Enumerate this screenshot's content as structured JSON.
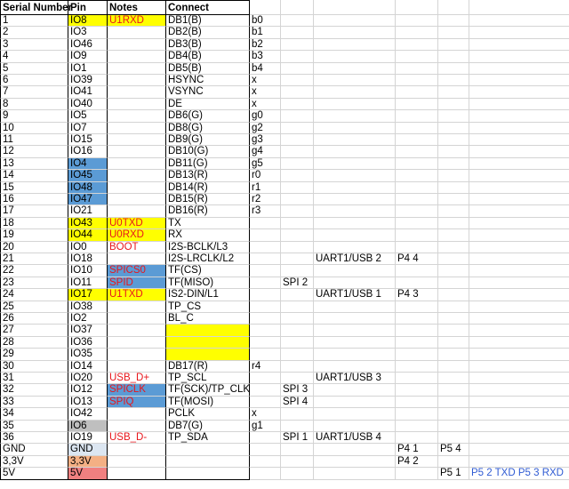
{
  "header": {
    "serial": "Serial Number",
    "pin": "Pin",
    "notes": "Notes",
    "connect": "Connect"
  },
  "colors": {
    "yellow": "#ffff00",
    "blue": "#5b9bd5",
    "gray": "#bfbfbf",
    "light_blue": "#dce6f1",
    "orange": "#f4b084",
    "pink": "#f08080",
    "red_text": "#e8161b",
    "blue_text": "#2f5bd3"
  },
  "rows": [
    {
      "sn": "1",
      "pin": "IO8",
      "pin_fill": "yellow",
      "note": "U1RXD",
      "note_fill": "yellow",
      "connect": "DB1(B)",
      "extra": "b0"
    },
    {
      "sn": "2",
      "pin": "IO3",
      "connect": "DB2(B)",
      "extra": "b1"
    },
    {
      "sn": "3",
      "pin": "IO46",
      "connect": "DB3(B)",
      "extra": "b2"
    },
    {
      "sn": "4",
      "pin": "IO9",
      "connect": "DB4(B)",
      "extra": "b3"
    },
    {
      "sn": "5",
      "pin": "IO1",
      "connect": "DB5(B)",
      "extra": "b4"
    },
    {
      "sn": "6",
      "pin": "IO39",
      "connect": "HSYNC",
      "extra": "x"
    },
    {
      "sn": "7",
      "pin": "IO41",
      "connect": "VSYNC",
      "extra": "x"
    },
    {
      "sn": "8",
      "pin": "IO40",
      "connect": "DE",
      "extra": "x"
    },
    {
      "sn": "9",
      "pin": "IO5",
      "connect": "DB6(G)",
      "extra": "g0"
    },
    {
      "sn": "10",
      "pin": "IO7",
      "connect": "DB8(G)",
      "extra": "g2"
    },
    {
      "sn": "11",
      "pin": "IO15",
      "connect": "DB9(G)",
      "extra": "g3"
    },
    {
      "sn": "12",
      "pin": "IO16",
      "connect": "DB10(G)",
      "extra": "g4"
    },
    {
      "sn": "13",
      "pin": "IO4",
      "pin_fill": "blue",
      "connect": "DB11(G)",
      "extra": "g5"
    },
    {
      "sn": "14",
      "pin": "IO45",
      "pin_fill": "blue",
      "connect": "DB13(R)",
      "extra": "r0"
    },
    {
      "sn": "15",
      "pin": "IO48",
      "pin_fill": "blue",
      "connect": "DB14(R)",
      "extra": "r1"
    },
    {
      "sn": "16",
      "pin": "IO47",
      "pin_fill": "blue",
      "connect": "DB15(R)",
      "extra": "r2"
    },
    {
      "sn": "17",
      "pin": "IO21",
      "connect": "DB16(R)",
      "extra": "r3"
    },
    {
      "sn": "18",
      "pin": "IO43",
      "pin_fill": "yellow",
      "note": "U0TXD",
      "note_fill": "yellow",
      "connect": "TX"
    },
    {
      "sn": "19",
      "pin": "IO44",
      "pin_fill": "yellow",
      "note": "U0RXD",
      "note_fill": "yellow",
      "connect": "RX"
    },
    {
      "sn": "20",
      "pin": "IO0",
      "note": "BOOT",
      "connect": "I2S-BCLK/L3"
    },
    {
      "sn": "21",
      "pin": "IO18",
      "connect": "I2S-LRCLK/L2",
      "uart": "UART1/USB 2",
      "p4": "P4 4"
    },
    {
      "sn": "22",
      "pin": "IO10",
      "note": "SPICS0",
      "note_fill": "blue",
      "connect": "TF(CS)"
    },
    {
      "sn": "23",
      "pin": "IO11",
      "note": "SPID",
      "note_fill": "blue",
      "connect": "TF(MISO)",
      "spi": "SPI 2"
    },
    {
      "sn": "24",
      "pin": "IO17",
      "pin_fill": "yellow",
      "note": "U1TXD",
      "note_fill": "yellow",
      "connect": "IS2-DIN/L1",
      "uart": "UART1/USB 1",
      "p4": "P4 3"
    },
    {
      "sn": "25",
      "pin": "IO38",
      "connect": "TP_CS"
    },
    {
      "sn": "26",
      "pin": "IO2",
      "connect": "BL_C"
    },
    {
      "sn": "27",
      "pin": "IO37",
      "connect": "",
      "connect_fill": "yellow"
    },
    {
      "sn": "28",
      "pin": "IO36",
      "connect": "",
      "connect_fill": "yellow"
    },
    {
      "sn": "29",
      "pin": "IO35",
      "connect": "",
      "connect_fill": "yellow"
    },
    {
      "sn": "30",
      "pin": "IO14",
      "connect": "DB17(R)",
      "extra": "r4"
    },
    {
      "sn": "31",
      "pin": "IO20",
      "note": "USB_D+",
      "connect": "TP_SCL",
      "uart": "UART1/USB 3"
    },
    {
      "sn": "32",
      "pin": "IO12",
      "note": "SPICLK",
      "note_fill": "blue",
      "connect": "TF(SCK)/TP_CLK",
      "spi": "SPI 3"
    },
    {
      "sn": "33",
      "pin": "IO13",
      "note": "SPIQ",
      "note_fill": "blue",
      "connect": "TF(MOSI)",
      "spi": "SPI 4"
    },
    {
      "sn": "34",
      "pin": "IO42",
      "connect": "PCLK",
      "extra": "x"
    },
    {
      "sn": "35",
      "pin": "IO6",
      "pin_fill": "gray",
      "connect": "DB7(G)",
      "extra": "g1"
    },
    {
      "sn": "36",
      "pin": "IO19",
      "note": "USB_D-",
      "connect": "TP_SDA",
      "spi": "SPI 1",
      "uart": "UART1/USB 4"
    },
    {
      "sn": "GND",
      "pin": "GND",
      "pin_fill": "light_blue",
      "p4": "P4 1",
      "p5": "P5 4"
    },
    {
      "sn": "3,3V",
      "pin": "3,3V",
      "pin_fill": "orange",
      "p4": "P4 2"
    },
    {
      "sn": "5V",
      "pin": "5V",
      "pin_fill": "pink",
      "p5": "P5 1",
      "p5note": "P5 2 TXD P5 3 RXD"
    }
  ]
}
